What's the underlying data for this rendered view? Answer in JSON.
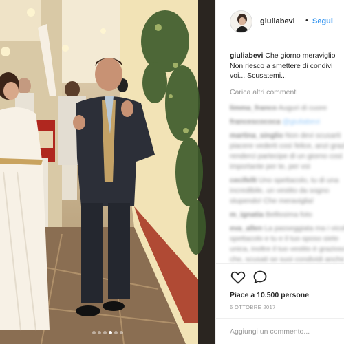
{
  "photo": {
    "carousel": {
      "count": 6,
      "active_index": 3
    }
  },
  "header": {
    "username": "giuliabevi",
    "separator": "•",
    "follow_label": "Segui"
  },
  "caption": {
    "username": "giuliabevi",
    "line1": "Che giorno meraviglio",
    "line2": "Non riesco a smettere di condivi",
    "line3": "voi... Scusatemi..."
  },
  "load_more_label": "Carica altri commenti",
  "comments": [
    {
      "user": "limma_franco",
      "text": "Auguri di cuore"
    },
    {
      "user": "francescococa",
      "text": "",
      "mention": "@giuliabevi"
    },
    {
      "user": "martina_singlio",
      "text": "Non devi scusarti"
    },
    {
      "user": "",
      "text": "piacere vederti così felice, anzi grazie"
    },
    {
      "user": "",
      "text": "renderci partecipe di un giorno così"
    },
    {
      "user": "",
      "text": "importante per te, per voi"
    },
    {
      "user": "cecifellt",
      "text": "Uno spettacolo, tu di una"
    },
    {
      "user": "",
      "text": "incredibile, un vestito da sogno"
    },
    {
      "user": "",
      "text": "stupendo! Che meraviglia!"
    },
    {
      "user": "m_ignatia",
      "text": "Bellissima foto"
    },
    {
      "user": "eva_allen",
      "text": "La passeggiata ma i vicoli"
    },
    {
      "user": "",
      "text": "spettacolo e tu e il tuo sposo siete"
    },
    {
      "user": "",
      "text": "unica, inoltre il tuo vestito è grazioso"
    },
    {
      "user": "",
      "text": "che, scusati se suoi condividi anche"
    }
  ],
  "actions": {
    "like_icon": "heart-icon",
    "comment_icon": "speech-bubble-icon"
  },
  "likes_text": "Piace a 10.500 persone",
  "date_text": "6 OTTOBRE 2017",
  "add_comment_placeholder": "Aggiungi un commento...",
  "colors": {
    "link_blue": "#3897f0",
    "text": "#262626",
    "muted": "#999999",
    "border": "#efefef"
  }
}
